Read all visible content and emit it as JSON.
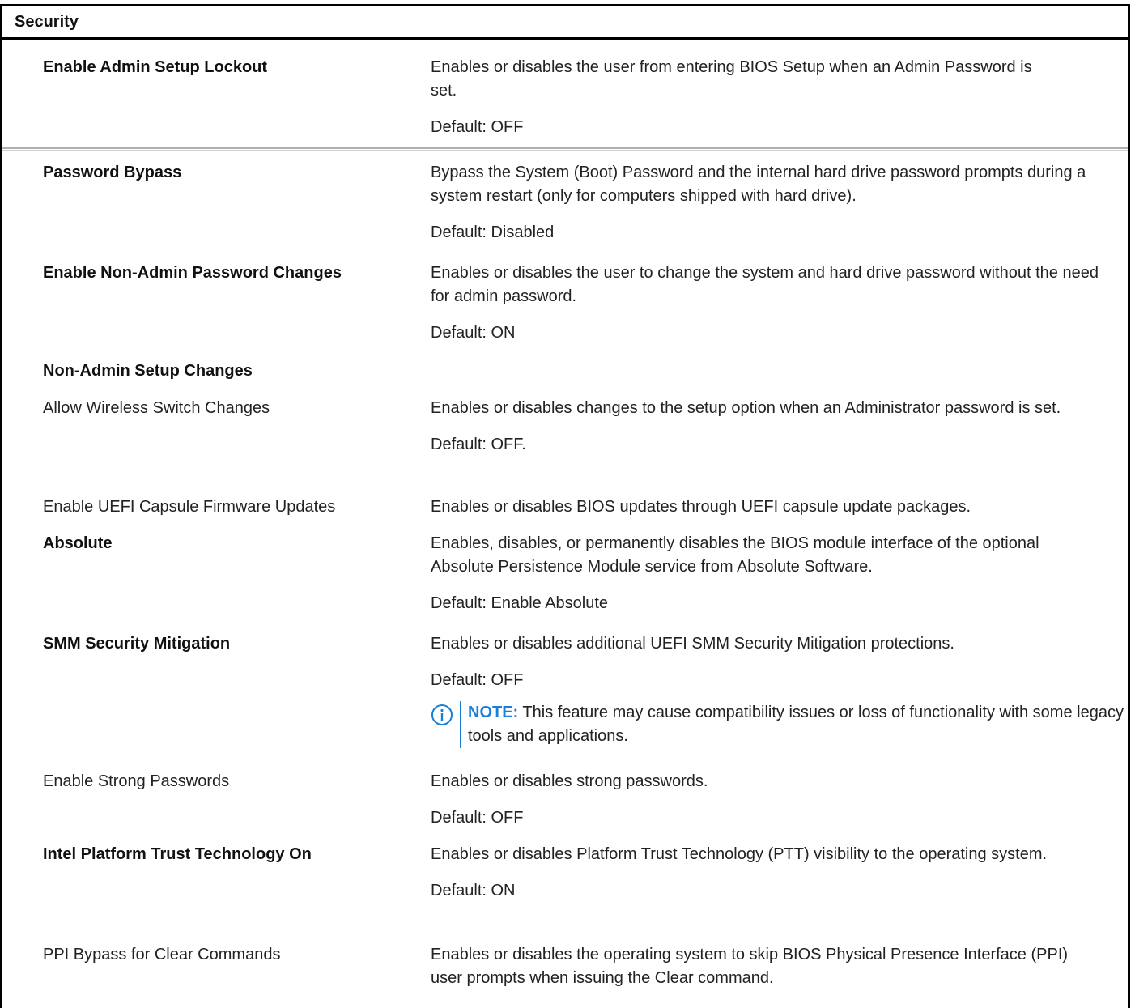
{
  "section_title": "Security",
  "rows": [
    {
      "name": "Enable Admin Setup Lockout",
      "desc": "Enables or disables the user from entering BIOS Setup when an Admin Password is set.",
      "default": "Default: OFF"
    },
    {
      "name": "Password Bypass",
      "desc": "Bypass the System (Boot) Password and the internal hard drive password prompts during a system restart (only for computers shipped with hard drive).",
      "default": "Default: Disabled"
    },
    {
      "name": "Enable Non-Admin Password Changes",
      "desc": "Enables or disables the user to change the system and hard drive password without the need for admin password.",
      "default": "Default: ON"
    },
    {
      "name": "Non-Admin Setup Changes"
    },
    {
      "name": "Allow Wireless Switch Changes",
      "desc": "Enables or disables changes to the setup option when an Administrator password is set.",
      "default": "Default: OFF."
    },
    {
      "name": "Enable UEFI Capsule Firmware Updates",
      "desc": "Enables or disables BIOS updates through UEFI capsule update packages."
    },
    {
      "name": "Absolute",
      "desc": "Enables, disables, or permanently disables the BIOS module interface of the optional Absolute Persistence Module service from Absolute Software.",
      "default": "Default: Enable Absolute"
    },
    {
      "name": "SMM Security Mitigation",
      "desc": "Enables or disables additional UEFI SMM Security Mitigation protections.",
      "default": "Default: OFF",
      "note_label": "NOTE:",
      "note_text": " This feature may cause compatibility issues or loss of functionality with some legacy tools and applications."
    },
    {
      "name": "Enable Strong Passwords",
      "desc": "Enables or disables strong passwords.",
      "default": "Default: OFF"
    },
    {
      "name": "Intel Platform Trust Technology On",
      "desc": "Enables or disables Platform Trust Technology (PTT) visibility to the operating system.",
      "default": "Default: ON"
    },
    {
      "name": "PPI Bypass for Clear Commands",
      "desc": "Enables or disables the operating system to skip BIOS Physical Presence Interface (PPI) user prompts when issuing the Clear command."
    }
  ]
}
